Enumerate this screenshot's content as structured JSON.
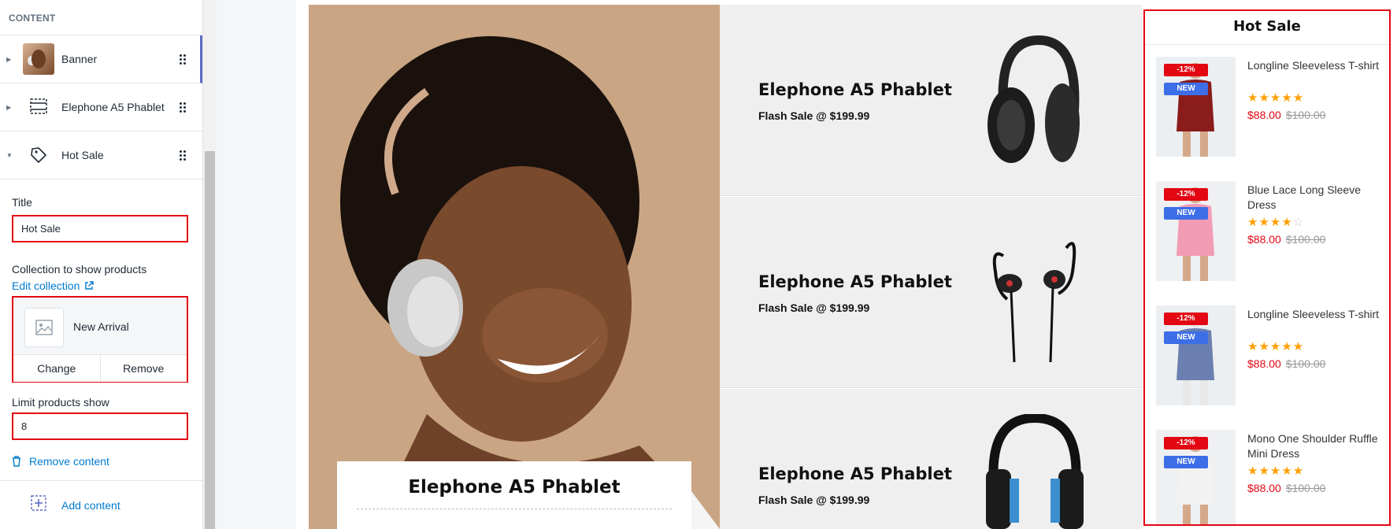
{
  "sidebar": {
    "header": "CONTENT",
    "items": [
      {
        "label": "Banner",
        "icon": "banner-thumbnail"
      },
      {
        "label": "Elephone A5 Phablet",
        "icon": "section-icon"
      },
      {
        "label": "Hot Sale",
        "icon": "tag-icon"
      }
    ],
    "settings": {
      "title_label": "Title",
      "title_value": "Hot Sale",
      "collection_label": "Collection to show products",
      "edit_collection": "Edit collection",
      "collection_name": "New Arrival",
      "change_label": "Change",
      "remove_label": "Remove",
      "limit_label": "Limit products show",
      "limit_value": "8",
      "remove_content": "Remove content"
    },
    "add_content": "Add content"
  },
  "preview": {
    "banner_title": "Elephone A5 Phablet",
    "promos": [
      {
        "title": "Elephone A5 Phablet",
        "subtitle": "Flash Sale @ $199.99"
      },
      {
        "title": "Elephone A5 Phablet",
        "subtitle": "Flash Sale @ $199.99"
      },
      {
        "title": "Elephone A5 Phablet",
        "subtitle": "Flash Sale @ $199.99"
      }
    ],
    "hot_sale": {
      "title": "Hot Sale",
      "products": [
        {
          "name": "Longline Sleeveless T-shirt",
          "sale_badge": "-12%",
          "new_badge": "NEW",
          "rating": 5,
          "price": "$88.00",
          "old_price": "$100.00"
        },
        {
          "name": "Blue Lace Long Sleeve Dress",
          "sale_badge": "-12%",
          "new_badge": "NEW",
          "rating": 4,
          "price": "$88.00",
          "old_price": "$100.00"
        },
        {
          "name": "Longline Sleeveless T-shirt",
          "sale_badge": "-12%",
          "new_badge": "NEW",
          "rating": 5,
          "price": "$88.00",
          "old_price": "$100.00"
        },
        {
          "name": "Mono One Shoulder Ruffle Mini Dress",
          "sale_badge": "-12%",
          "new_badge": "NEW",
          "rating": 5,
          "price": "$88.00",
          "old_price": "$100.00"
        }
      ]
    }
  },
  "colors": {
    "accent": "#007ace",
    "highlight": "#e30613",
    "sale": "#e30613",
    "new": "#3d6ee8",
    "star": "#ff9f00"
  }
}
